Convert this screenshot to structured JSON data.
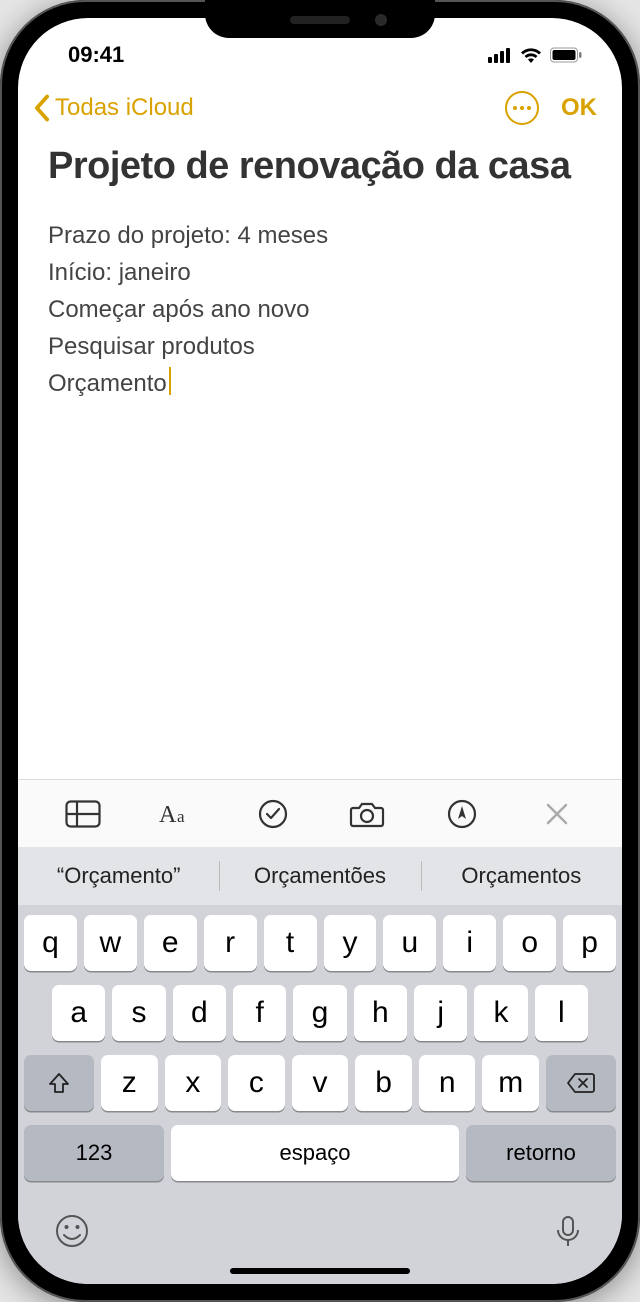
{
  "status": {
    "time": "09:41"
  },
  "nav": {
    "back_label": "Todas iCloud",
    "ok_label": "OK"
  },
  "note": {
    "title": "Projeto de renovação da casa",
    "lines": [
      "Prazo do projeto: 4 meses",
      "Início: janeiro",
      "Começar após ano novo",
      "Pesquisar produtos",
      "Orçamento"
    ]
  },
  "suggestions": [
    "“Orçamento”",
    "Orçamentões",
    "Orçamentos"
  ],
  "keyboard": {
    "row1": [
      "q",
      "w",
      "e",
      "r",
      "t",
      "y",
      "u",
      "i",
      "o",
      "p"
    ],
    "row2": [
      "a",
      "s",
      "d",
      "f",
      "g",
      "h",
      "j",
      "k",
      "l"
    ],
    "row3": [
      "z",
      "x",
      "c",
      "v",
      "b",
      "n",
      "m"
    ],
    "numeric_label": "123",
    "space_label": "espaço",
    "return_label": "retorno"
  }
}
